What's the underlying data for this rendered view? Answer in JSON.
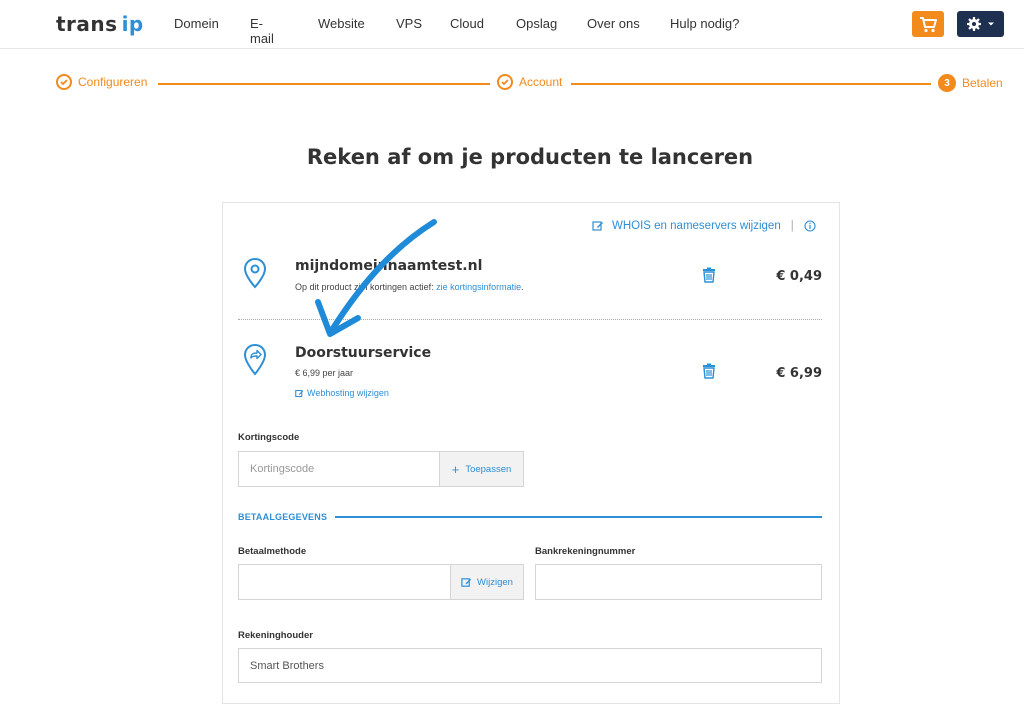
{
  "nav": {
    "logo_trans": "trans",
    "logo_ip": "ip",
    "items": [
      {
        "label": "Domein"
      },
      {
        "label": "E-mail"
      },
      {
        "label": "Website"
      },
      {
        "label": "VPS"
      },
      {
        "label": "Cloud"
      },
      {
        "label": "Opslag"
      },
      {
        "label": "Over ons"
      },
      {
        "label": "Hulp nodig?"
      }
    ],
    "cart_icon": "cart-icon",
    "settings_icon": "gear-icon",
    "accent": "#f38a1c",
    "dark": "#1e3050"
  },
  "stepper": {
    "steps": [
      {
        "label": "Configureren",
        "state": "done"
      },
      {
        "label": "Account",
        "state": "done"
      },
      {
        "label": "Betalen",
        "state": "current",
        "number": "3"
      }
    ]
  },
  "page": {
    "title": "Reken af om je producten te lanceren"
  },
  "card": {
    "whois_link": "WHOIS en nameservers wijzigen",
    "whois_sep": "|",
    "products": [
      {
        "name": "mijndomeinnaamtest.nl",
        "desc_prefix": "Op dit product zijn kortingen actief: ",
        "desc_link": "zie kortingsinformatie",
        "desc_suffix": ".",
        "price": "€ 0,49",
        "icon": "location-pin-icon"
      },
      {
        "name": "Doorstuurservice",
        "desc": "€ 6,99 per jaar",
        "link": "Webhosting wijzigen",
        "price": "€ 6,99",
        "icon": "forward-pin-icon"
      }
    ],
    "coupon": {
      "label": "Kortingscode",
      "placeholder": "Kortingscode",
      "button": "Toepassen"
    },
    "payment": {
      "section": "BETAALGEGEVENS",
      "method_label": "Betaalmethode",
      "method_button": "Wijzigen",
      "iban_label": "Bankrekeningnummer",
      "holder_label": "Rekeninghouder",
      "holder_value": "Smart Brothers"
    }
  },
  "colors": {
    "blue": "#2d8fd5",
    "orange": "#f38a1c"
  }
}
